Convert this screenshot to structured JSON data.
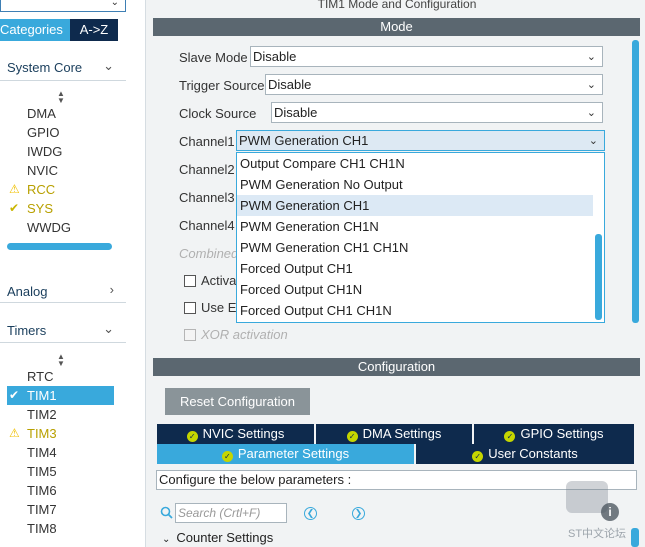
{
  "window_title": "TIM1 Mode and Configuration",
  "left": {
    "tabs": {
      "categories": "Categories",
      "az": "A->Z"
    },
    "sections": {
      "system_core": "System Core",
      "analog": "Analog",
      "timers": "Timers"
    },
    "system_core_items": [
      {
        "label": "DMA",
        "status": "none"
      },
      {
        "label": "GPIO",
        "status": "none"
      },
      {
        "label": "IWDG",
        "status": "none"
      },
      {
        "label": "NVIC",
        "status": "none"
      },
      {
        "label": "RCC",
        "status": "warning"
      },
      {
        "label": "SYS",
        "status": "ok"
      },
      {
        "label": "WWDG",
        "status": "none"
      }
    ],
    "timers_items": [
      {
        "label": "RTC",
        "status": "none"
      },
      {
        "label": "TIM1",
        "status": "ok",
        "selected": true
      },
      {
        "label": "TIM2",
        "status": "none"
      },
      {
        "label": "TIM3",
        "status": "warning"
      },
      {
        "label": "TIM4",
        "status": "none"
      },
      {
        "label": "TIM5",
        "status": "none"
      },
      {
        "label": "TIM6",
        "status": "none"
      },
      {
        "label": "TIM7",
        "status": "none"
      },
      {
        "label": "TIM8",
        "status": "none"
      }
    ]
  },
  "mode": {
    "band_label": "Mode",
    "slave_mode": {
      "label": "Slave Mode",
      "value": "Disable"
    },
    "trigger_source": {
      "label": "Trigger Source",
      "value": "Disable"
    },
    "clock_source": {
      "label": "Clock Source",
      "value": "Disable"
    },
    "channel1": {
      "label": "Channel1",
      "value": "PWM Generation CH1"
    },
    "channel2": {
      "label": "Channel2"
    },
    "channel3": {
      "label": "Channel3"
    },
    "channel4": {
      "label": "Channel4"
    },
    "combined": "Combined",
    "activate": "Activat",
    "use_e": "Use E",
    "xor_activation": "XOR activation",
    "dropdown_options": [
      "Output Compare CH1 CH1N",
      "PWM Generation No Output",
      "PWM Generation CH1",
      "PWM Generation CH1N",
      "PWM Generation CH1 CH1N",
      "Forced Output CH1",
      "Forced Output CH1N",
      "Forced Output CH1 CH1N"
    ],
    "dropdown_highlighted_index": 2
  },
  "configuration": {
    "band_label": "Configuration",
    "reset_button": "Reset Configuration",
    "tabs_row1": [
      "NVIC Settings",
      "DMA Settings",
      "GPIO Settings"
    ],
    "tabs_row2": [
      "Parameter Settings",
      "User Constants"
    ],
    "configure_label": "Configure the below parameters :",
    "search_placeholder": "Search (Crtl+F)",
    "counter_settings": "Counter Settings"
  },
  "watermark": {
    "text": "ST中文论坛"
  },
  "colors": {
    "accent": "#39a9dc",
    "navy": "#0e2a4d",
    "band": "#5b6770",
    "warning": "#f0c000",
    "ok": "#c9b500"
  }
}
